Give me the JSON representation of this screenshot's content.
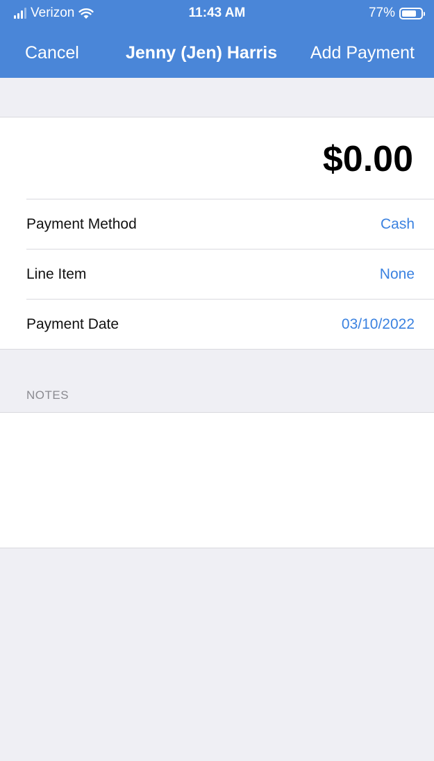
{
  "status_bar": {
    "carrier": "Verizon",
    "time": "11:43 AM",
    "battery": "77%",
    "battery_level": 0.77,
    "icons": [
      "signal-icon",
      "wifi-icon",
      "battery-icon"
    ]
  },
  "nav": {
    "cancel_label": "Cancel",
    "title": "Jenny (Jen) Harris",
    "add_label": "Add Payment"
  },
  "payment": {
    "amount": "$0.00",
    "rows": [
      {
        "label": "Payment Method",
        "value": "Cash"
      },
      {
        "label": "Line Item",
        "value": "None"
      },
      {
        "label": "Payment Date",
        "value": "03/10/2022"
      }
    ]
  },
  "notes": {
    "header": "NOTES",
    "value": ""
  },
  "colors": {
    "nav_bg": "#4a86d8",
    "accent": "#3b82e0",
    "background": "#efeff4"
  }
}
